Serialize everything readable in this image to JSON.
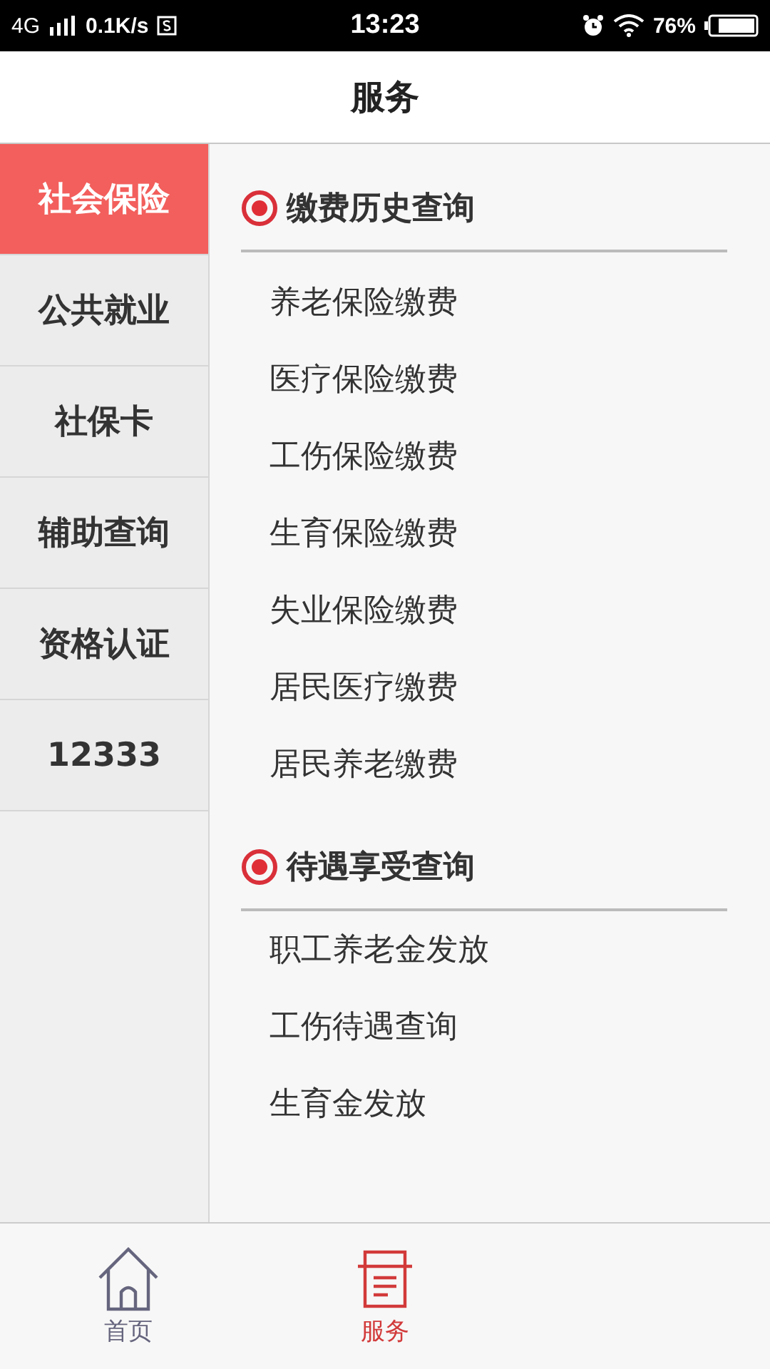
{
  "status_bar": {
    "network": "4G",
    "speed": "0.1K/s",
    "time": "13:23",
    "battery": "76%"
  },
  "header": {
    "title": "服务"
  },
  "sidebar": {
    "items": [
      {
        "label": "社会保险",
        "selected": true
      },
      {
        "label": "公共就业",
        "selected": false
      },
      {
        "label": "社保卡",
        "selected": false
      },
      {
        "label": "辅助查询",
        "selected": false
      },
      {
        "label": "资格认证",
        "selected": false
      },
      {
        "label": "12333",
        "selected": false
      }
    ]
  },
  "sections": [
    {
      "title": "缴费历史查询",
      "items": [
        "养老保险缴费",
        "医疗保险缴费",
        "工伤保险缴费",
        "生育保险缴费",
        "失业保险缴费",
        "居民医疗缴费",
        "居民养老缴费"
      ]
    },
    {
      "title": "待遇享受查询",
      "items": [
        "职工养老金发放",
        "工伤待遇查询",
        "生育金发放"
      ]
    }
  ],
  "tab_bar": [
    {
      "label": "首页",
      "selected": false,
      "kind": "home"
    },
    {
      "label": "服务",
      "selected": true,
      "kind": "service"
    }
  ]
}
